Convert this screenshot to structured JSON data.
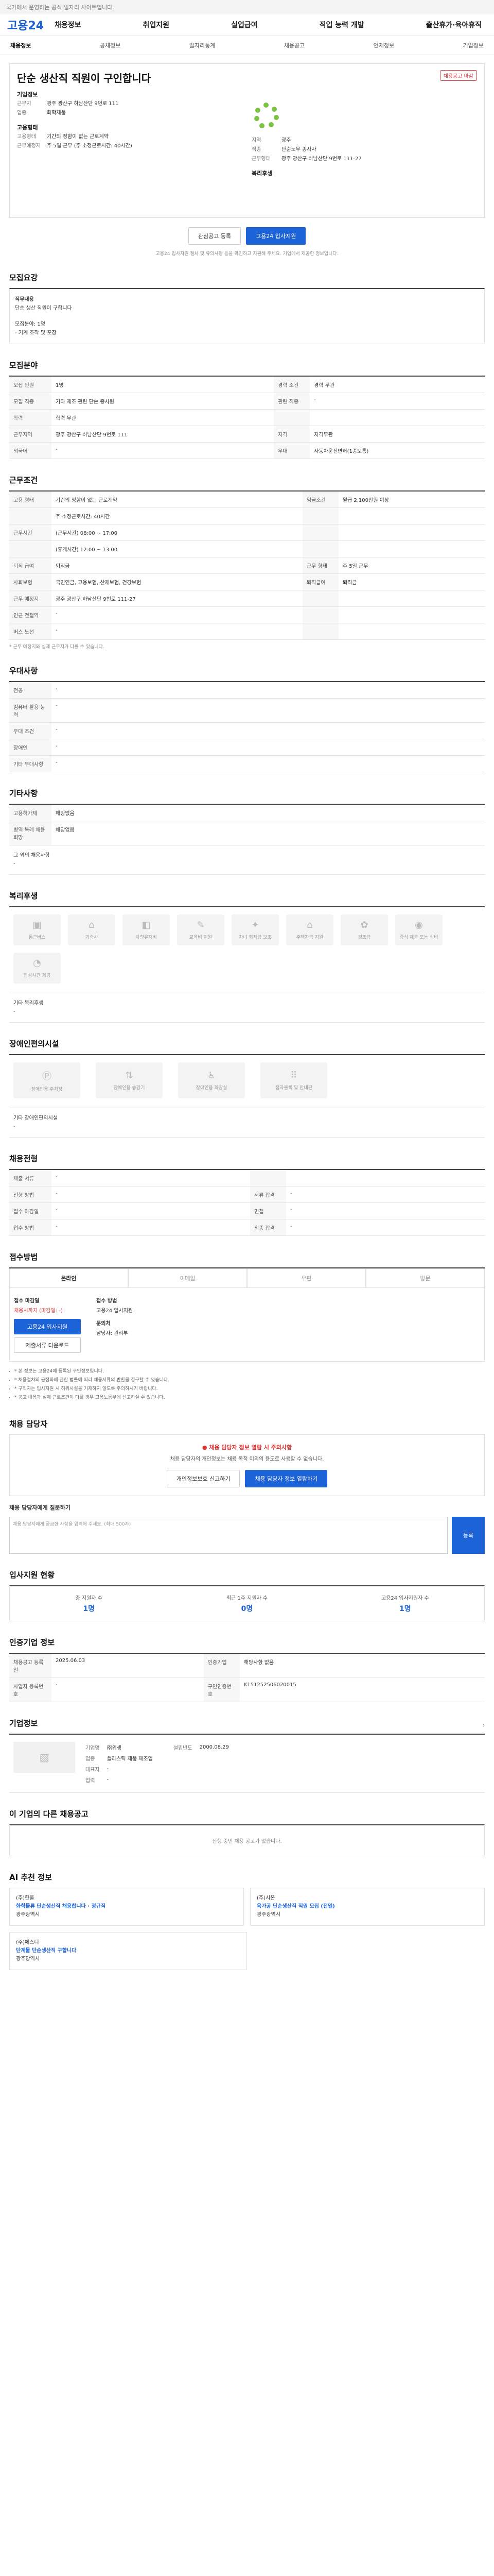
{
  "topbar": {
    "text": "국가에서 운영하는 공식 일자리 사이트입니다."
  },
  "header": {
    "logo": "고용24",
    "nav": [
      "채용정보",
      "취업지원",
      "실업급여",
      "직업 능력 개발",
      "출산휴가·육아휴직"
    ]
  },
  "subnav": [
    "채용정보",
    "공채정보",
    "일자리통계",
    "채용공고",
    "인재정보",
    "기업정보"
  ],
  "job": {
    "badge": "채용공고 마감",
    "title": "단순 생산직 직원이 구인합니다",
    "company": {
      "label": "기업정보",
      "rows": [
        [
          "근무지",
          "광주 광산구 하남산단 9번로 111"
        ],
        [
          "업종",
          "화학제품"
        ]
      ]
    },
    "employ": {
      "label": "고용형태",
      "rows": [
        [
          "고용형태",
          "기간의 정함이 없는 근로계약"
        ],
        [
          "근무예정지",
          "주 5일 근무 (주 소정근로시간: 40시간)"
        ]
      ]
    },
    "welfare_label": "복리후생",
    "right_rows": [
      [
        "지역",
        "광주"
      ],
      [
        "직종",
        "단순노무 종사자"
      ],
      [
        "근무형태",
        "광주 광산구 하남산단 9번로 111-27"
      ]
    ],
    "buttons": {
      "interest": "관심공고 등록",
      "apply": "고용24 입사지원"
    },
    "note": "고용24 입사지원 절차 및 유의사항 등을 확인하고 지원해 주세요. 기업에서 제공한 정보입니다."
  },
  "sections": {
    "duty": {
      "title": "모집요강",
      "label": "직무내용",
      "lines": [
        "단순 생산 직원이 구합니다",
        "",
        "모집분야: 1명",
        "- 기계 조작 및 포장"
      ]
    },
    "recruit": {
      "title": "모집분야",
      "rows": [
        [
          "모집 인원",
          "1명",
          "경력 조건",
          "경력 무관"
        ],
        [
          "모집 직종",
          "기타 제조 관련 단순 종사원",
          "관련 직종",
          "-"
        ],
        [
          "학력",
          "학력 무관",
          "",
          ""
        ],
        [
          "근무지역",
          "광주 광산구 하남산단 9번로 111",
          "자격",
          "자격무관"
        ],
        [
          "외국어",
          "-",
          "우대",
          "자동차운전면허(1종보통)"
        ]
      ]
    },
    "workcond": {
      "title": "근무조건",
      "rows": [
        [
          "고용 형태",
          "기간의 정함이 없는 근로계약",
          "임금조건",
          "월급 2,100만원 이상"
        ],
        [
          "",
          "주 소정근로시간: 40시간",
          "",
          ""
        ],
        [
          "근무시간",
          "(근무시간) 08:00 ~ 17:00",
          "",
          ""
        ],
        [
          "",
          "(휴게시간) 12:00 ~ 13:00",
          "",
          ""
        ],
        [
          "퇴직 급여",
          "퇴직금",
          "근무 형태",
          "주 5일 근무"
        ],
        [
          "사회보험",
          "국민연금, 고용보험, 산재보험, 건강보험",
          "퇴직급여",
          "퇴직금"
        ],
        [
          "근무 예정지",
          "광주 광산구 하남산단 9번로 111-27",
          "",
          ""
        ],
        [
          "인근 전철역",
          "-",
          "",
          ""
        ],
        [
          "버스 노선",
          "-",
          "",
          ""
        ]
      ],
      "note": "* 근무 예정지와 실제 근무지가 다를 수 있습니다."
    },
    "prefer": {
      "title": "우대사항",
      "rows": [
        [
          "전공",
          "-"
        ],
        [
          "컴퓨터 활용 능력",
          "-"
        ],
        [
          "우대 조건",
          "-"
        ],
        [
          "장애인",
          "-"
        ],
        [
          "기타 우대사항",
          "-"
        ]
      ]
    },
    "etc": {
      "title": "기타사항",
      "rows": [
        [
          "고용허가제",
          "해당없음"
        ],
        [
          "병역 특례 채용희망",
          "해당없음"
        ]
      ],
      "extra_label": "그 외의 채용사항",
      "extra_value": "-"
    },
    "welfare": {
      "title": "복리후생",
      "items": [
        "통근버스",
        "기숙사",
        "차량유지비",
        "교육비 지원",
        "자녀 학자금 보조",
        "주택자금 지원",
        "경조금",
        "중식 제공 또는 식비",
        "점심시간 제공"
      ],
      "other_label": "기타 복리후생",
      "other_value": "-"
    },
    "disability": {
      "title": "장애인편의시설",
      "items": [
        "장애인용 주차장",
        "장애인용 승강기",
        "장애인용 화장실",
        "점자블록 및 안내판"
      ],
      "other_label": "기타 장애인편의시설",
      "other_value": "-"
    },
    "process": {
      "title": "채용전형",
      "rows": [
        [
          "제출 서류",
          "-"
        ],
        [
          "전형 방법",
          "-"
        ],
        [
          "접수 마감일",
          "-"
        ],
        [
          "접수 방법",
          "-"
        ]
      ],
      "right": [
        [
          "서류 합격",
          "-"
        ],
        [
          "면접",
          "-"
        ],
        [
          "최종 합격",
          "-"
        ]
      ]
    },
    "apply": {
      "title": "접수방법",
      "tabs": [
        "온라인",
        "이메일",
        "우편",
        "방문"
      ],
      "deadline_label": "접수 마감일",
      "deadline": "채용시까지 (마감일: -)",
      "method_label": "접수 방법",
      "method": "고용24 입사지원",
      "apply_btn": "고용24 입사지원",
      "docs_btn": "제출서류 다운로드",
      "contact_label": "문의처",
      "contact": "담당자: 관리부",
      "warnings": [
        "* 본 정보는 고용24에 등록된 구인정보입니다.",
        "* 채용절차의 공정화에 관한 법률에 따라 채용서류의 반환을 청구할 수 있습니다.",
        "* 구직자는 입사지원 시 허위사실을 기재하지 않도록 주의하시기 바랍니다.",
        "* 공고 내용과 실제 근로조건이 다를 경우 고용노동부에 신고하실 수 있습니다."
      ]
    },
    "manager": {
      "title": "채용 담당자",
      "alert": "채용 담당자 정보 열람 시 주의사항",
      "desc": "채용 담당자의 개인정보는 채용 목적 이외의 용도로 사용할 수 없습니다.",
      "btn_view": "채용 담당자 정보 열람하기",
      "btn_report": "개인정보보호 신고하기",
      "q_label": "채용 담당자에게 질문하기",
      "q_placeholder": "채용 담당자에게 궁금한 사항을 입력해 주세요. (최대 500자)",
      "q_btn": "등록"
    },
    "stats": {
      "title": "입사지원 현황",
      "items": [
        [
          "총 지원자 수",
          "1명"
        ],
        [
          "최근 1주 지원자 수",
          "0명"
        ],
        [
          "고용24 입사지원자 수",
          "1명"
        ]
      ]
    },
    "info": {
      "title": "인증기업 정보",
      "rows": [
        [
          "채용공고 등록일",
          "2025.06.03",
          "인증기업",
          "해당사항 없음"
        ],
        [
          "사업자 등록번호",
          "-",
          "구인인증번호",
          "K151252506020015"
        ]
      ]
    },
    "company": {
      "title": "기업정보",
      "rows": [
        [
          "기업명",
          "㈜위생"
        ],
        [
          "업종",
          "플라스틱 제품 제조업"
        ],
        [
          "대표자",
          "-"
        ],
        [
          "업력",
          "-"
        ]
      ],
      "founded": [
        "설립년도",
        "2000.08.29"
      ]
    },
    "other_jobs": {
      "title": "이 기업의 다른 채용공고",
      "empty": "진행 중인 채용 공고가 없습니다."
    },
    "recommend": {
      "title": "AI 추천 정보",
      "cards": [
        {
          "company": "(주)한울",
          "title": "화학물류 단순생산직 채용합니다 · 정규직",
          "loc": "광주광역시"
        },
        {
          "company": "(주)시온",
          "title": "육가공 단순생산직 직원 모집 (전일)",
          "loc": "광주광역시"
        },
        {
          "company": "(주)에스디",
          "title": "단계물 단순생산직 구합니다",
          "loc": "광주광역시"
        }
      ]
    }
  }
}
